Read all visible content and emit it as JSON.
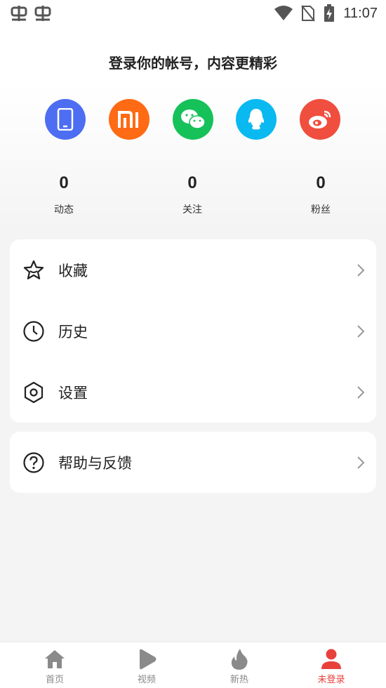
{
  "status_bar": {
    "time": "11:07"
  },
  "login_prompt": "登录你的帐号，内容更精彩",
  "login_methods": [
    {
      "name": "phone",
      "color": "#4d6ef2"
    },
    {
      "name": "xiaomi",
      "color": "#ff6a14"
    },
    {
      "name": "wechat",
      "color": "#16c15a"
    },
    {
      "name": "qq",
      "color": "#0bb9f1"
    },
    {
      "name": "weibo",
      "color": "#f04e3e"
    }
  ],
  "stats": [
    {
      "value": "0",
      "label": "动态"
    },
    {
      "value": "0",
      "label": "关注"
    },
    {
      "value": "0",
      "label": "粉丝"
    }
  ],
  "menu": {
    "favorites": "收藏",
    "history": "历史",
    "settings": "设置",
    "help": "帮助与反馈"
  },
  "bottom_nav": [
    {
      "label": "首页",
      "icon": "home-icon",
      "active": false
    },
    {
      "label": "视频",
      "icon": "video-icon",
      "active": false
    },
    {
      "label": "新热",
      "icon": "flame-icon",
      "active": false
    },
    {
      "label": "未登录",
      "icon": "user-icon",
      "active": true
    }
  ],
  "colors": {
    "accent": "#e8413c",
    "inactive": "#888888"
  }
}
